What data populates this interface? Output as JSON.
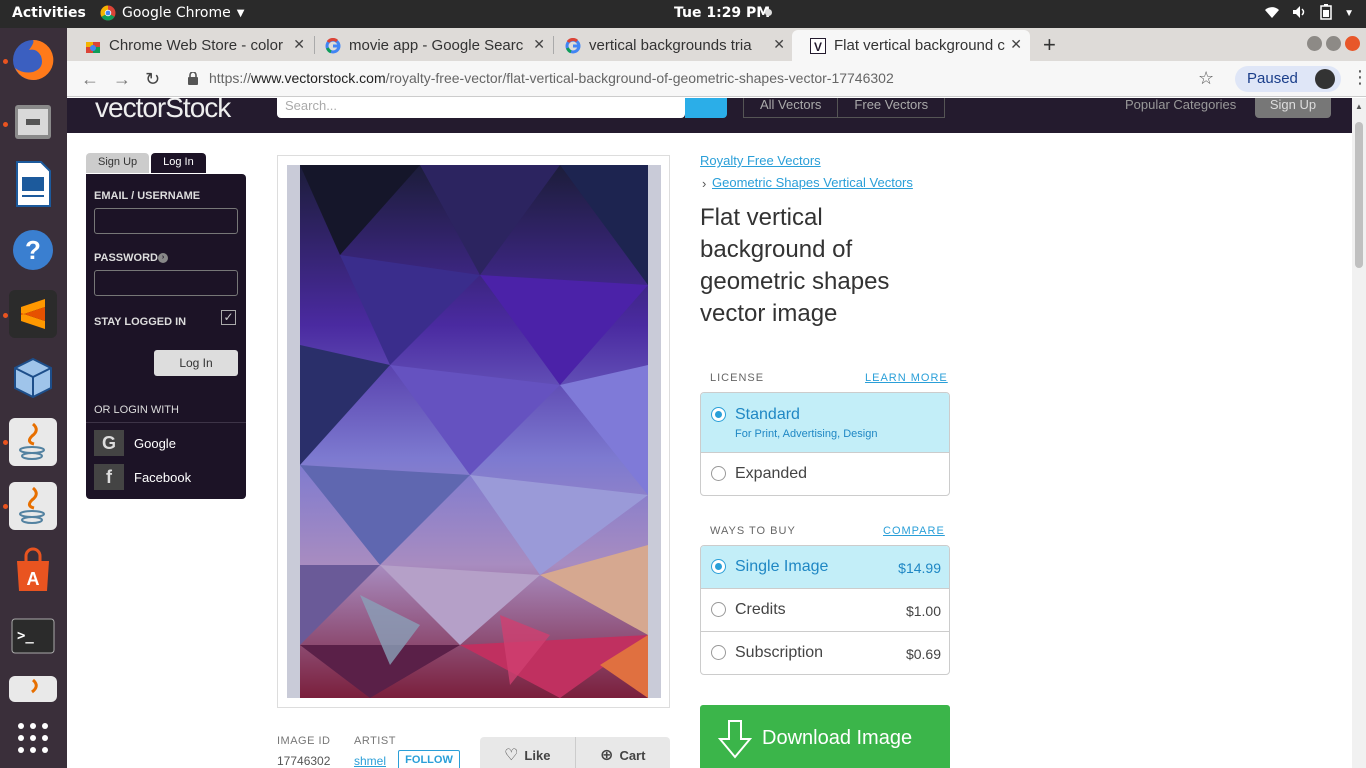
{
  "topbar": {
    "activities": "Activities",
    "app_menu": "Google Chrome",
    "clock": "Tue  1:29 PM"
  },
  "tabs": [
    {
      "title": "Chrome Web Store - color",
      "icon": "webstore-icon"
    },
    {
      "title": "movie app - Google Searc",
      "icon": "google-icon"
    },
    {
      "title": "vertical backgrounds tria",
      "icon": "google-icon"
    },
    {
      "title": "Flat vertical background c",
      "icon": "vectorstock-icon",
      "active": true
    }
  ],
  "omnibox": {
    "scheme": "https://",
    "host": "www.vectorstock.com",
    "path": "/royalty-free-vector/flat-vertical-background-of-geometric-shapes-vector-17746302",
    "profile_label": "Paused"
  },
  "site_header": {
    "logo": "vectorStock",
    "search_placeholder": "Search...",
    "links": [
      "All Vectors",
      "Free Vectors"
    ],
    "popular": "Popular Categories",
    "signup": "Sign Up"
  },
  "login": {
    "tab_signup": "Sign Up",
    "tab_login": "Log In",
    "email_label": "EMAIL / USERNAME",
    "password_label": "PASSWORD",
    "stay_logged_in": "STAY LOGGED IN",
    "login_button": "Log In",
    "or_login_with": "OR LOGIN WITH",
    "google": "Google",
    "facebook": "Facebook"
  },
  "breadcrumbs": [
    "Royalty Free Vectors",
    "Geometric Shapes Vertical Vectors"
  ],
  "title": "Flat vertical background of geometric shapes vector image",
  "license": {
    "heading": "LICENSE",
    "link": "LEARN MORE",
    "options": [
      {
        "name": "Standard",
        "sub": "For Print, Advertising, Design",
        "selected": true
      },
      {
        "name": "Expanded",
        "selected": false
      }
    ]
  },
  "ways_to_buy": {
    "heading": "WAYS TO BUY",
    "link": "COMPARE",
    "options": [
      {
        "name": "Single Image",
        "price": "$14.99",
        "selected": true
      },
      {
        "name": "Credits",
        "price": "$1.00",
        "selected": false
      },
      {
        "name": "Subscription",
        "price": "$0.69",
        "selected": false
      }
    ]
  },
  "download_label": "Download Image",
  "image_meta": {
    "id_label": "IMAGE ID",
    "id_value": "17746302",
    "artist_label": "ARTIST",
    "artist_value": "shmel",
    "follow": "FOLLOW",
    "like": "Like",
    "cart": "Cart"
  },
  "colors": {
    "site_header_bg": "#241b2e",
    "accent_blue": "#2a9fd8",
    "download_green": "#3bb54a",
    "selected_option_bg": "#c3eef8",
    "dock_bg": "#3a2f3a",
    "ubuntu_orange": "#e95420"
  }
}
